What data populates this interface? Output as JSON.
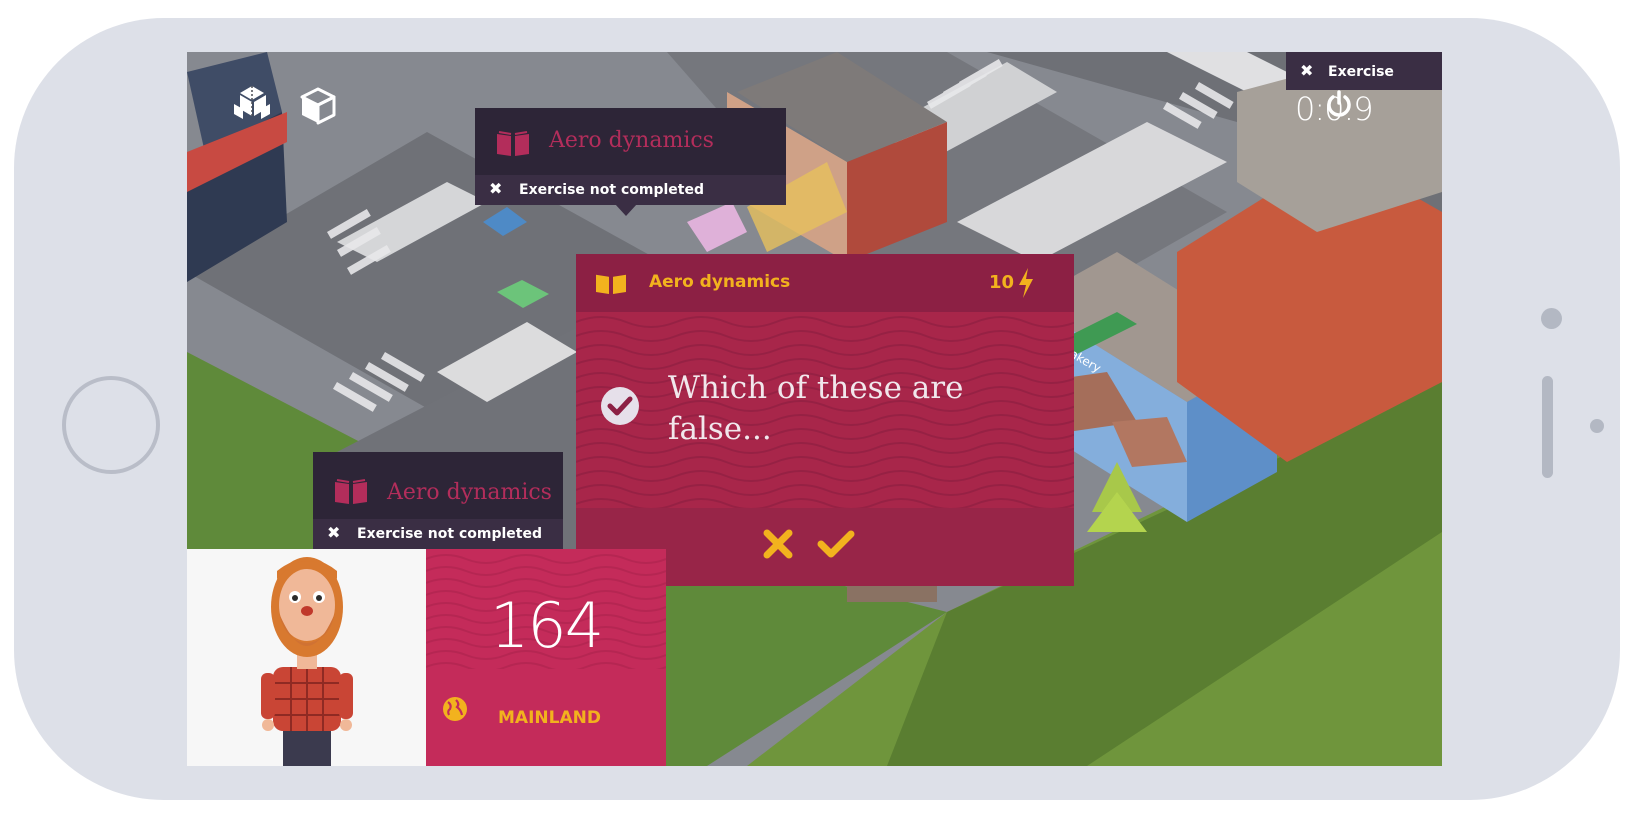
{
  "hud": {
    "timer": "0:0:9",
    "menu_icon": "blocks-icon",
    "cube_icon": "cube-icon",
    "power_icon": "power-icon"
  },
  "popups": [
    {
      "title": "Aero dynamics",
      "status": "Exercise not completed"
    },
    {
      "title": "Aero dynamics",
      "status": "Exercise not completed"
    },
    {
      "title": "",
      "status": "Exercise"
    }
  ],
  "question": {
    "topic": "Aero dynamics",
    "points": "10",
    "text": "Which of these are false...",
    "book_icon": "book-icon",
    "bolt_icon": "lightning-icon",
    "check_icon": "checkmark-circle-icon",
    "reject_icon": "close-icon",
    "accept_icon": "checkmark-icon"
  },
  "player": {
    "score": "164",
    "region": "MAINLAND",
    "avatar": "bearded-man-avatar",
    "region_icon": "globe-icon"
  },
  "colors": {
    "accent": "#f2b21e",
    "card": "#a8264a",
    "card_head": "#8c2044",
    "score_bg": "#c42b5a",
    "popup_bg": "#2d2537",
    "title_pink": "#b32d5b"
  }
}
